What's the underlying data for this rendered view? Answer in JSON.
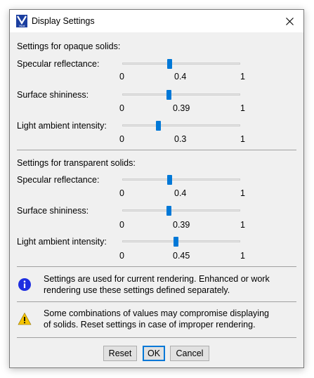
{
  "window": {
    "title": "Display Settings",
    "app_icon_text": "Visual",
    "colors": {
      "accent": "#0078d7",
      "info": "#1e2ee0",
      "warning": "#f5c400"
    }
  },
  "opaque": {
    "title": "Settings for opaque solids:",
    "sliders": [
      {
        "label": "Specular reflectance:",
        "min": "0",
        "max": "1",
        "value": "0.4",
        "fraction": 0.4
      },
      {
        "label": "Surface shininess:",
        "min": "0",
        "max": "1",
        "value": "0.39",
        "fraction": 0.39
      },
      {
        "label": "Light ambient intensity:",
        "min": "0",
        "max": "1",
        "value": "0.3",
        "fraction": 0.3
      }
    ]
  },
  "transparent": {
    "title": "Settings for transparent solids:",
    "sliders": [
      {
        "label": "Specular reflectance:",
        "min": "0",
        "max": "1",
        "value": "0.4",
        "fraction": 0.4
      },
      {
        "label": "Surface shininess:",
        "min": "0",
        "max": "1",
        "value": "0.39",
        "fraction": 0.39
      },
      {
        "label": "Light ambient intensity:",
        "min": "0",
        "max": "1",
        "value": "0.45",
        "fraction": 0.45
      }
    ]
  },
  "notes": {
    "info": {
      "icon": "info-icon",
      "line1": "Settings are used for current rendering. Enhanced or work",
      "line2": "rendering use these settings defined separately."
    },
    "warning": {
      "icon": "warning-icon",
      "line1": "Some combinations of values may compromise displaying",
      "line2": "of solids. Reset settings in case of improper rendering."
    }
  },
  "buttons": {
    "reset": "Reset",
    "ok": "OK",
    "cancel": "Cancel"
  }
}
